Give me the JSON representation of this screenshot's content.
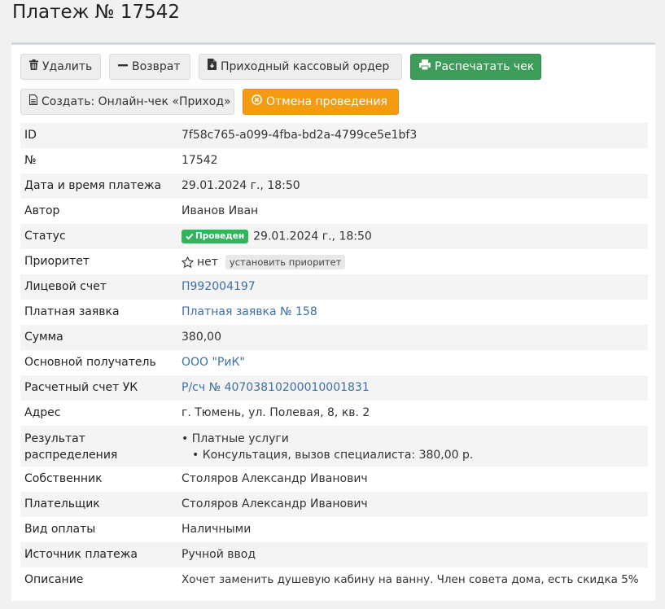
{
  "page": {
    "title": "Платеж № 17542"
  },
  "toolbar": {
    "delete_label": "Удалить",
    "refund_label": "Возврат",
    "cash_order_label": "Приходный кассовый ордер",
    "print_receipt_label": "Распечатать чек",
    "create_online_receipt_label": "Создать: Онлайн-чек «Приход»",
    "cancel_posting_label": "Отмена проведения"
  },
  "colors": {
    "success": "#3d9c5a",
    "warning": "#f39c12",
    "badge_ok": "#2fb55b",
    "link": "#3c6fa6"
  },
  "details": {
    "id": {
      "label": "ID",
      "value": "7f58c765-a099-4fba-bd2a-4799ce5e1bf3"
    },
    "number": {
      "label": "№",
      "value": "17542"
    },
    "datetime": {
      "label": "Дата и время платежа",
      "value": "29.01.2024 г., 18:50"
    },
    "author": {
      "label": "Автор",
      "value": "Иванов Иван"
    },
    "status": {
      "label": "Статус",
      "badge": "Проведен",
      "value": "29.01.2024 г., 18:50"
    },
    "priority": {
      "label": "Приоритет",
      "value": "нет",
      "action": "установить приоритет"
    },
    "account": {
      "label": "Лицевой счет",
      "value": "П992004197"
    },
    "paid_request": {
      "label": "Платная заявка",
      "value": "Платная заявка № 158"
    },
    "amount": {
      "label": "Сумма",
      "value": "380,00"
    },
    "recipient": {
      "label": "Основной получатель",
      "value": "ООО \"РиК\""
    },
    "bank_account": {
      "label": "Расчетный счет УК",
      "value": "Р/сч № 40703810200010001831"
    },
    "address": {
      "label": "Адрес",
      "value": "г. Тюмень, ул. Полевая, 8, кв. 2"
    },
    "distribution": {
      "label_line1": "Результат",
      "label_line2": "распределения",
      "item": "• Платные услуги",
      "subitem": "• Консультация, вызов специалиста: 380,00 р."
    },
    "owner": {
      "label": "Собственник",
      "value": "Столяров Александр Иванович"
    },
    "payer": {
      "label": "Плательщик",
      "value": "Столяров Александр Иванович"
    },
    "payment_type": {
      "label": "Вид оплаты",
      "value": "Наличными"
    },
    "source": {
      "label": "Источник платежа",
      "value": "Ручной ввод"
    },
    "description": {
      "label": "Описание",
      "value": "Хочет заменить душевую кабину на ванну. Член совета дома, есть скидка 5%"
    }
  }
}
